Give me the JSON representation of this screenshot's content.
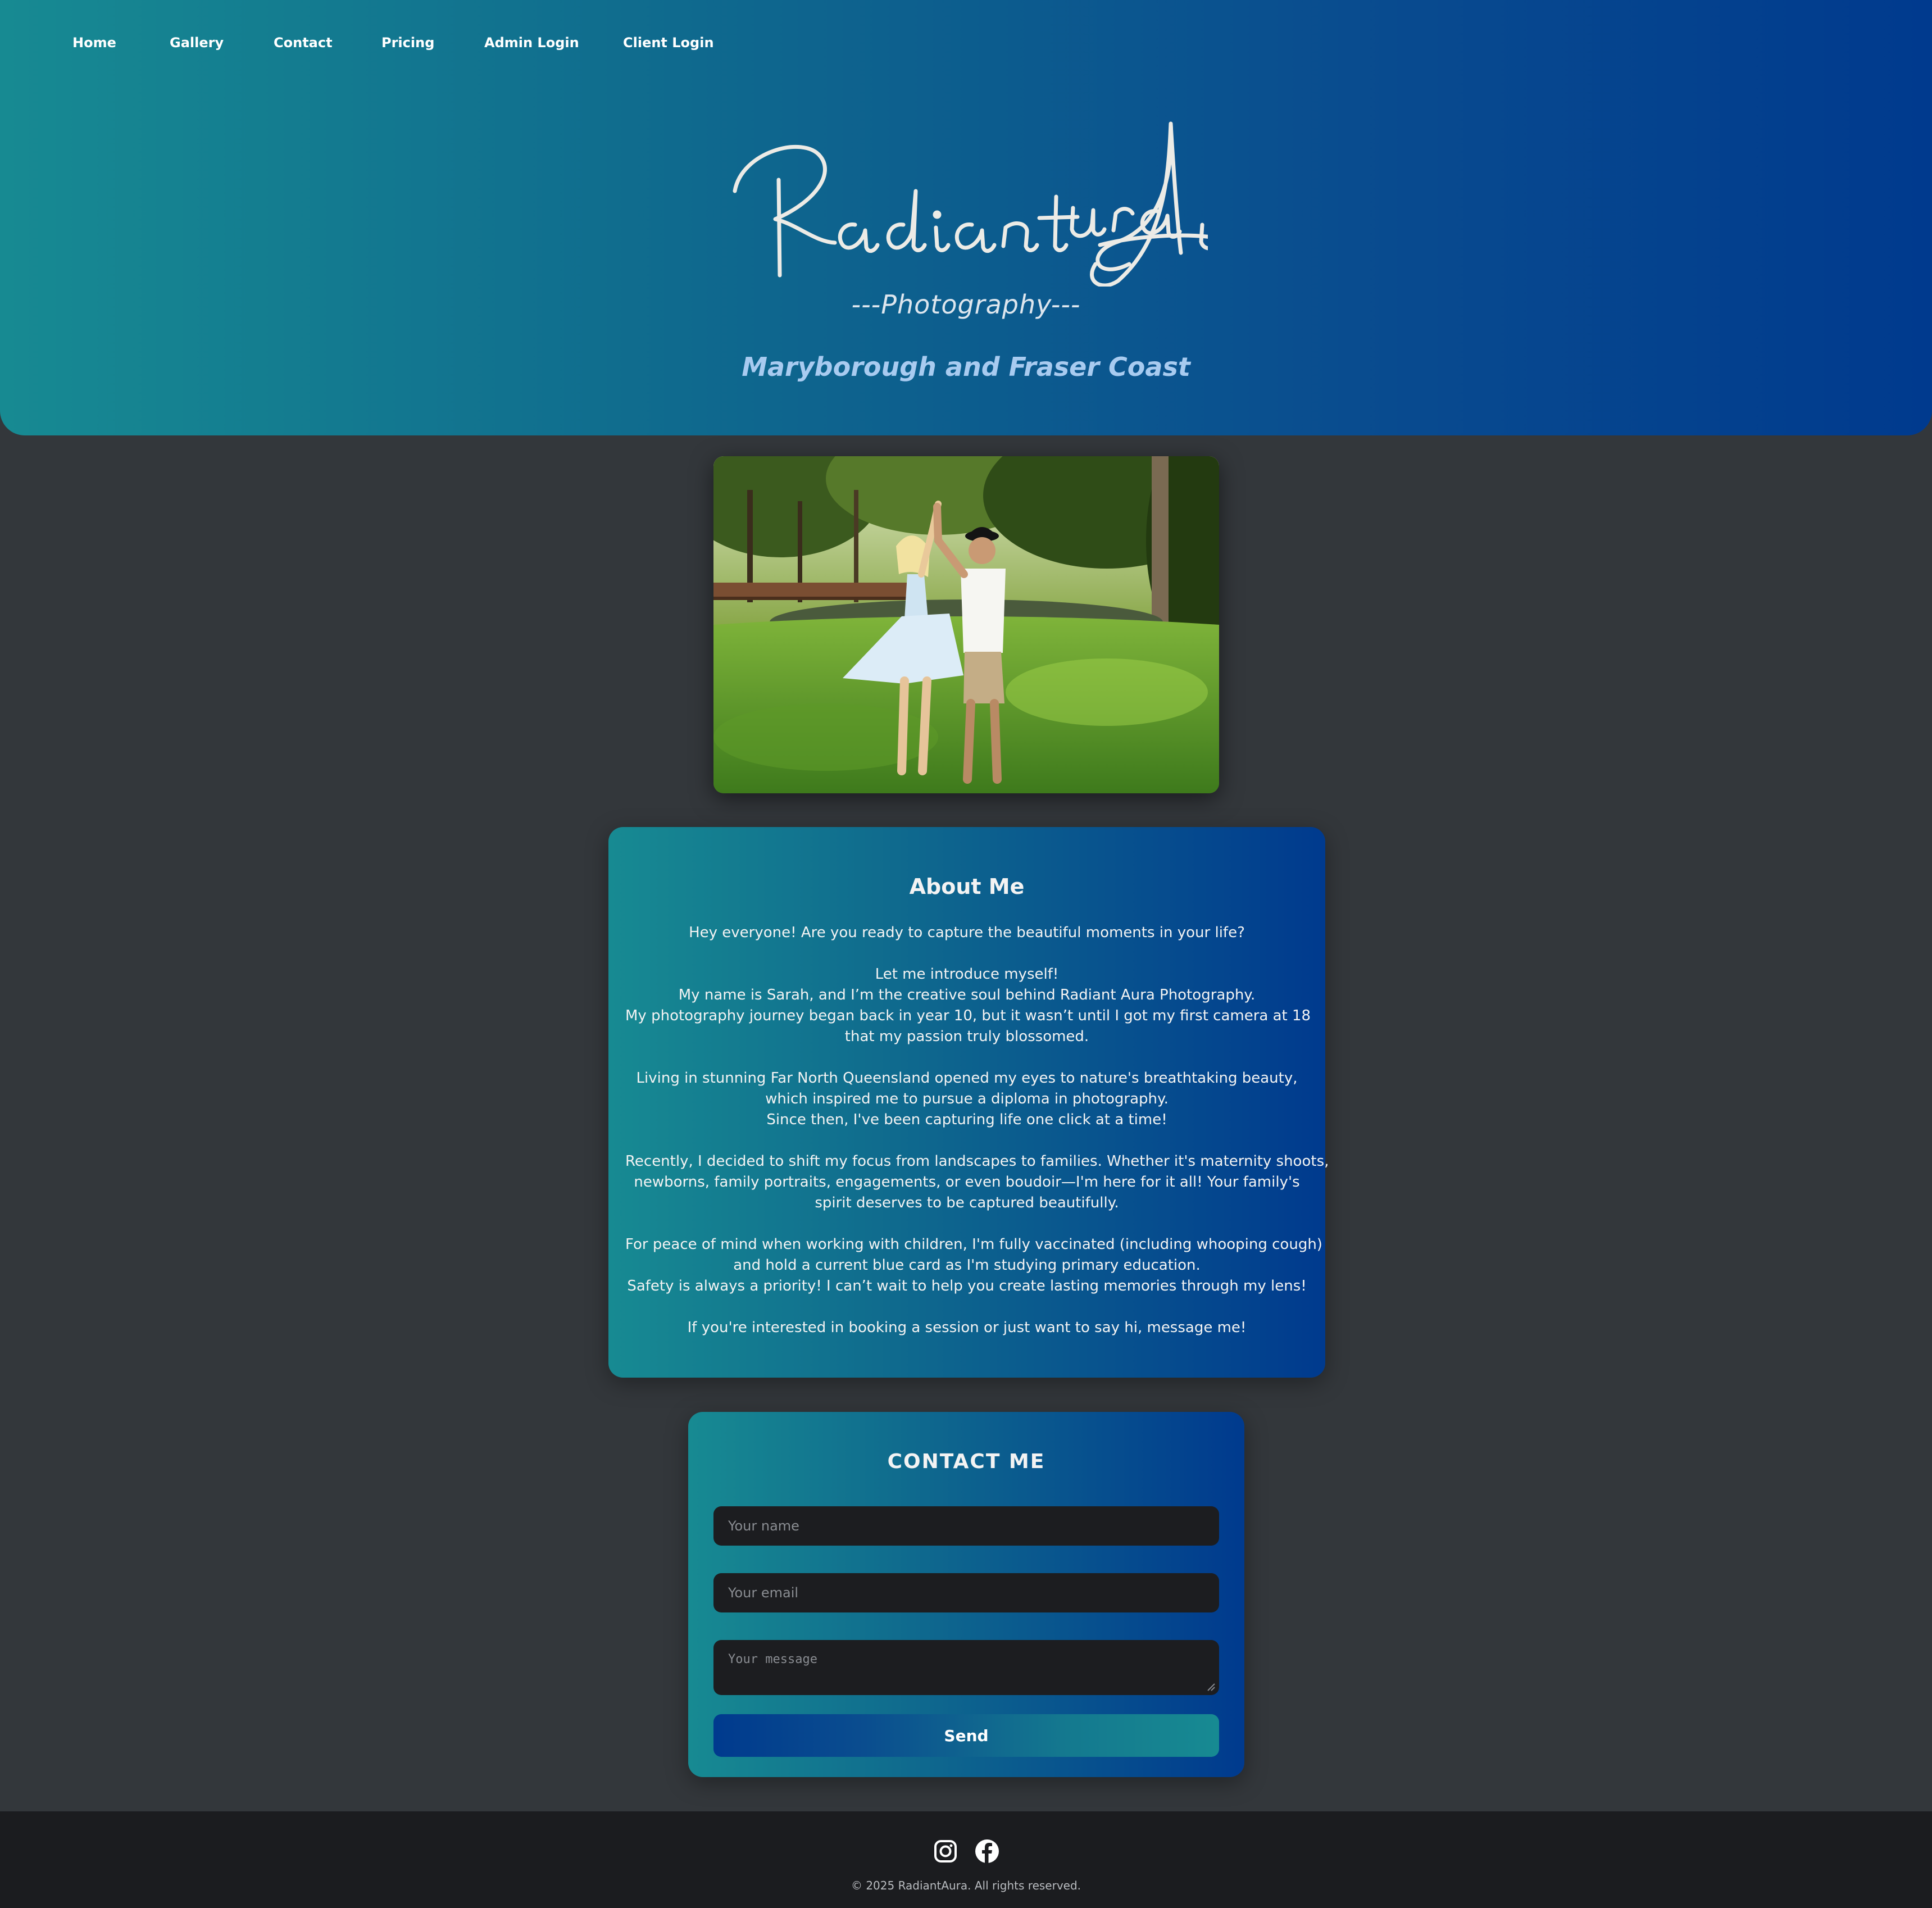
{
  "nav": {
    "items": [
      {
        "label": "Home"
      },
      {
        "label": "Gallery"
      },
      {
        "label": "Contact"
      },
      {
        "label": "Pricing"
      },
      {
        "label": "Admin Login"
      },
      {
        "label": "Client Login"
      }
    ]
  },
  "hero": {
    "logo_text": "Radiant Aura",
    "subtitle": "---Photography---",
    "tagline": "Maryborough and Fraser Coast"
  },
  "photo": {
    "description_icon": "couple-dancing-photo"
  },
  "about": {
    "title": "About Me",
    "paragraphs": [
      [
        "Hey everyone! Are you ready to capture the beautiful moments in your life?"
      ],
      [
        "Let me introduce myself!",
        "My name is Sarah, and I’m the creative soul behind Radiant Aura Photography.",
        "My photography journey began back in year 10, but it wasn’t until I got my first camera at 18",
        "that my passion truly blossomed."
      ],
      [
        "Living in stunning Far North Queensland opened my eyes to nature's breathtaking beauty,",
        "which inspired me to pursue a diploma in photography.",
        "Since then, I've been capturing life one click at a time!"
      ],
      [
        "Recently, I decided to shift my focus from landscapes to families. Whether it's maternity shoots,",
        "newborns, family portraits, engagements, or even boudoir—I'm here for it all! Your family's",
        "spirit deserves to be captured beautifully."
      ],
      [
        "For peace of mind when working with children, I'm fully vaccinated (including whooping cough)",
        "and hold a current blue card as I'm studying primary education.",
        "Safety is always a priority! I can’t wait to help you create lasting memories through my lens!"
      ],
      [
        "If you're interested in booking a session or just want to say hi, message me!"
      ]
    ]
  },
  "contact": {
    "title": "CONTACT ME",
    "name_placeholder": "Your name",
    "email_placeholder": "Your email",
    "message_placeholder": "Your message",
    "send_label": "Send"
  },
  "footer": {
    "icons": [
      "instagram-icon",
      "facebook-icon"
    ],
    "copyright": "© 2025 RadiantAura. All rights reserved."
  },
  "colors": {
    "gradient_start": "#178a92",
    "gradient_end": "#003a8e",
    "page_background": "#33373b",
    "footer_background": "#1b1c1f",
    "tagline": "#a8cbf0"
  }
}
